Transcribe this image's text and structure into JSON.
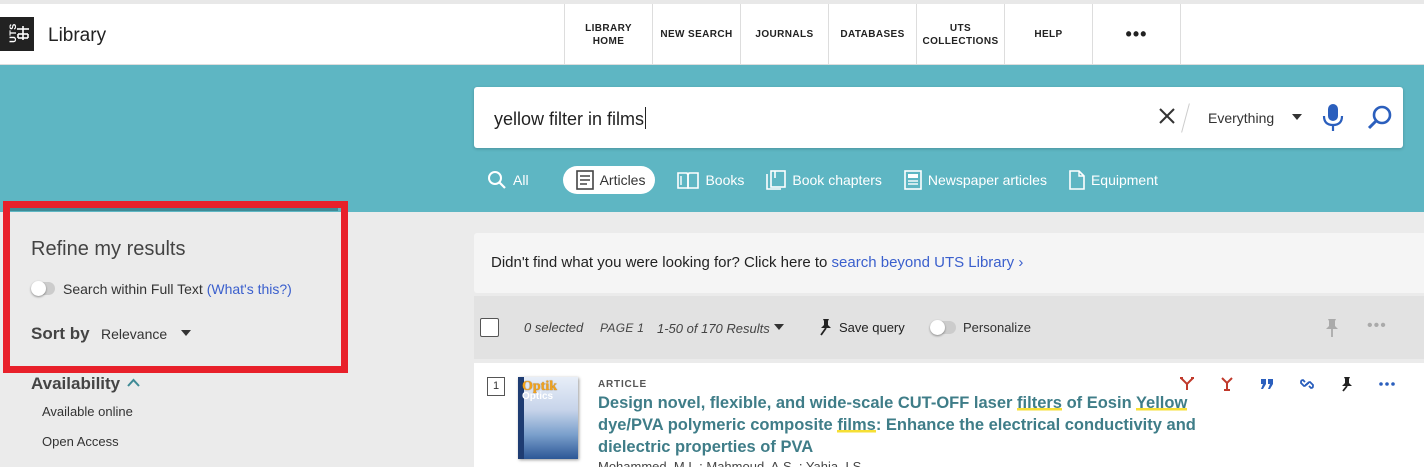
{
  "header": {
    "logo_text": "UTS",
    "brand": "Library",
    "nav": [
      {
        "label": "LIBRARY\nHOME"
      },
      {
        "label": "NEW SEARCH"
      },
      {
        "label": "JOURNALS"
      },
      {
        "label": "DATABASES"
      },
      {
        "label": "UTS\nCOLLECTIONS"
      },
      {
        "label": "HELP"
      },
      {
        "label": "•••"
      }
    ]
  },
  "search": {
    "query": "yellow filter in films",
    "scope": "Everything"
  },
  "tabs": [
    {
      "label": "All",
      "icon": "search-icon"
    },
    {
      "label": "Articles",
      "icon": "article-icon",
      "active": true
    },
    {
      "label": "Books",
      "icon": "book-icon"
    },
    {
      "label": "Book chapters",
      "icon": "book-chapter-icon"
    },
    {
      "label": "Newspaper articles",
      "icon": "newspaper-icon"
    },
    {
      "label": "Equipment",
      "icon": "document-icon"
    }
  ],
  "sidebar": {
    "title": "Refine my results",
    "fulltext_label": "Search within Full Text",
    "fulltext_link": "(What's this?)",
    "sortby_label": "Sort by",
    "sortby_value": "Relevance",
    "availability_title": "Availability",
    "facets": [
      "Available online",
      "Open Access"
    ]
  },
  "banner": {
    "text": "Didn't find what you were looking for? Click here to ",
    "link": "search beyond UTS Library",
    "chevron": "›"
  },
  "toolbar": {
    "selected": "0 selected",
    "page": "PAGE 1",
    "results": "1-50 of 170 Results",
    "save_query": "Save query",
    "personalize": "Personalize",
    "more": "•••"
  },
  "results": [
    {
      "number": "1",
      "cover_title": "Optik",
      "cover_subtitle": "Optics",
      "type": "ARTICLE",
      "title_parts": [
        {
          "text": "Design novel, flexible, and wide-scale CUT-OFF laser "
        },
        {
          "text": "filters",
          "hl": true
        },
        {
          "text": " of Eosin "
        },
        {
          "text": "Yellow",
          "hl": true
        },
        {
          "text": " dye/PVA polymeric composite "
        },
        {
          "text": "films",
          "hl": true
        },
        {
          "text": ": Enhance the electrical conductivity and dielectric properties of PVA"
        }
      ],
      "authors": "Mohammed, M.I. ; Mahmoud, A.S. ; Yahia, I.S.",
      "actions": [
        "citation-trail-icon",
        "cited-by-icon",
        "quote-icon",
        "link-icon",
        "pin-icon",
        "more-icon"
      ]
    }
  ],
  "colors": {
    "teal": "#5eb6c3",
    "link": "#3a5fcd",
    "title": "#3f7d88",
    "highlight": "#f6df35",
    "red_frame": "#e8202a",
    "action_red": "#c0392b",
    "action_blue": "#2b5fbd"
  }
}
